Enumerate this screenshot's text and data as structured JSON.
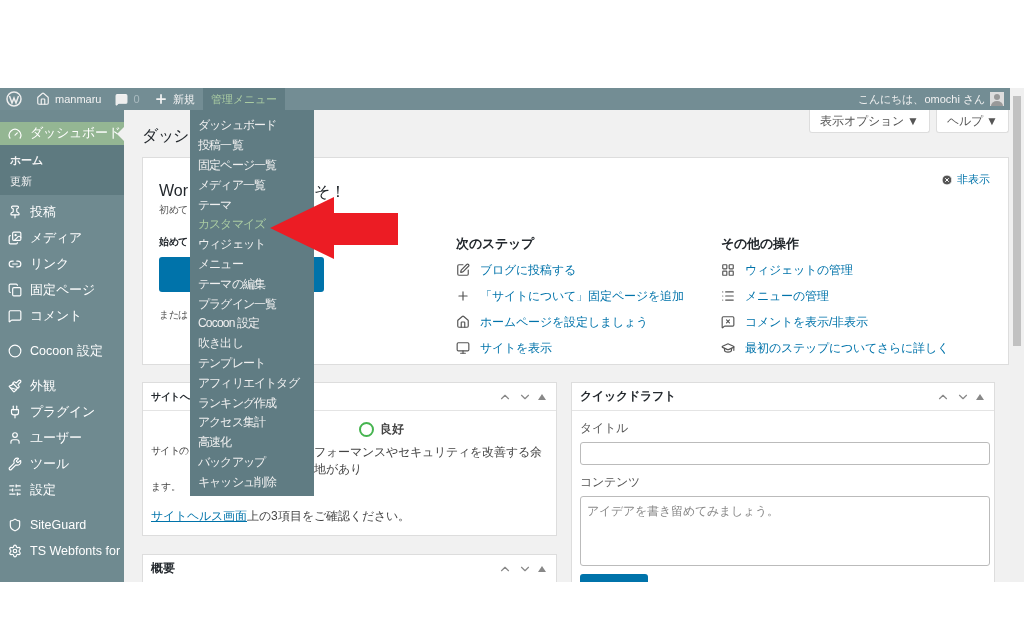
{
  "admin_bar": {
    "site": "manmaru",
    "comments": "0",
    "new_label": "新規",
    "menu": {
      "label": "管理メニュー",
      "expanded": true
    },
    "greeting": "こんにちは、omochi さん"
  },
  "admin_menu": [
    {
      "label": "ダッシュボード",
      "selected": false
    },
    {
      "label": "投稿一覧",
      "selected": false
    },
    {
      "label": "固定ページ一覧",
      "selected": false
    },
    {
      "label": "メディア一覧",
      "selected": false
    },
    {
      "label": "テーマ",
      "selected": false
    },
    {
      "label": "カスタマイズ",
      "selected": true
    },
    {
      "label": "ウィジェット",
      "selected": false
    },
    {
      "label": "メニュー",
      "selected": false
    },
    {
      "label": "テーマの編集",
      "selected": false
    },
    {
      "label": "プラグイン一覧",
      "selected": false
    },
    {
      "label": "Cocoon 設定",
      "selected": false
    },
    {
      "label": "吹き出し",
      "selected": false
    },
    {
      "label": "テンプレート",
      "selected": false
    },
    {
      "label": "アフィリエイトタグ",
      "selected": false
    },
    {
      "label": "ランキング作成",
      "selected": false
    },
    {
      "label": "アクセス集計",
      "selected": false
    },
    {
      "label": "高速化",
      "selected": false
    },
    {
      "label": "バックアップ",
      "selected": false
    },
    {
      "label": "キャッシュ削除",
      "selected": false
    }
  ],
  "sidebar": {
    "groups": [
      [
        {
          "label": "ダッシュボード",
          "selected": true,
          "children": [
            {
              "label": "ホーム",
              "selected": true
            },
            {
              "label": "更新",
              "selected": false
            }
          ]
        },
        {
          "label": "投稿",
          "selected": false
        },
        {
          "label": "メディア",
          "selected": false
        },
        {
          "label": "リンク",
          "selected": false
        },
        {
          "label": "固定ページ",
          "selected": false
        },
        {
          "label": "コメント",
          "selected": false
        }
      ],
      [
        {
          "label": "Cocoon 設定",
          "selected": false
        }
      ],
      [
        {
          "label": "外観",
          "selected": false
        },
        {
          "label": "プラグイン",
          "selected": false
        },
        {
          "label": "ユーザー",
          "selected": false
        },
        {
          "label": "ツール",
          "selected": false
        },
        {
          "label": "設定",
          "selected": false
        }
      ],
      [
        {
          "label": "SiteGuard",
          "selected": false
        },
        {
          "label": "TS Webfonts for",
          "selected": false
        }
      ]
    ]
  },
  "page": {
    "title": "ダッシ",
    "screen_options": "表示オプション ▼",
    "help": "ヘルプ ▼"
  },
  "welcome": {
    "title_start": "Wor",
    "title_end": "そ！",
    "subtitle_start": "初めて",
    "dismiss": "非表示",
    "start": {
      "heading": "始めて",
      "or_text": "または"
    },
    "next_steps": {
      "heading": "次のステップ",
      "items": [
        "ブログに投稿する",
        "「サイトについて」固定ページを追加",
        "ホームページを設定しましょう",
        "サイトを表示"
      ]
    },
    "more_actions": {
      "heading": "その他の操作",
      "items": [
        "ウィジェットの管理",
        "メニューの管理",
        "コメントを表示/非表示",
        "最初のステップについてさらに詳しく"
      ]
    }
  },
  "site_health": {
    "title": "サイトへ",
    "status": "良好",
    "text_start": "サイトの",
    "text_end": "フォーマンスやセキュリティを改善する余地があり",
    "text_wrap": "ます。",
    "link": "サイトヘルス画面",
    "link_after": "上の3項目をご確認ください。"
  },
  "overview": {
    "title": "概要"
  },
  "quick_draft": {
    "title": "クイックドラフト",
    "title_label": "タイトル",
    "content_label": "コンテンツ",
    "content_placeholder": "アイデアを書き留めてみましょう。"
  }
}
